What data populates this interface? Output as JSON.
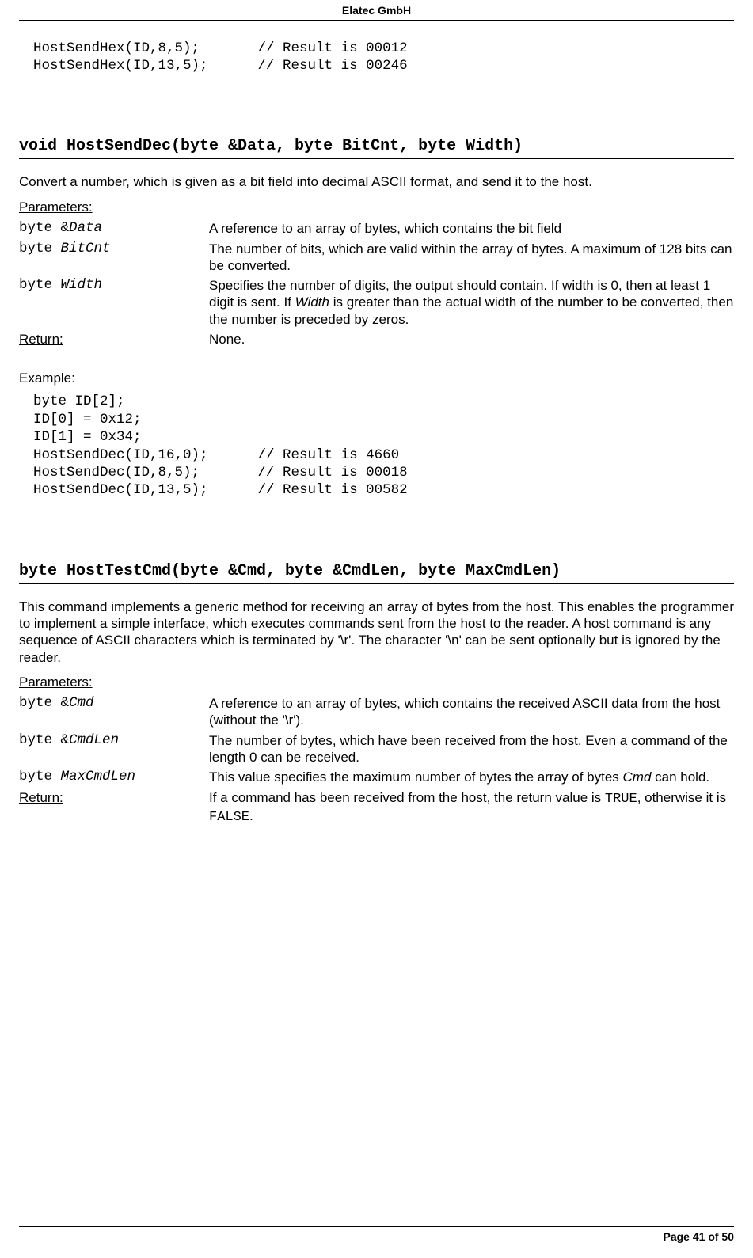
{
  "header": {
    "company": "Elatec GmbH"
  },
  "footer": {
    "page": "Page 41 of 50"
  },
  "intro_code": "HostSendHex(ID,8,5);       // Result is 00012\nHostSendHex(ID,13,5);      // Result is 00246",
  "s1": {
    "title": "void HostSendDec(byte &Data, byte BitCnt, byte Width)",
    "desc": "Convert a number, which is given as a bit field into decimal ASCII format, and send it to the host.",
    "params_h": "Parameters:",
    "p1_type": "byte &",
    "p1_name": "Data",
    "p1_desc": "A reference to an array of bytes, which contains the bit field",
    "p2_type": "byte ",
    "p2_name": "BitCnt",
    "p2_desc": "The number of bits, which are valid within the array of bytes. A maximum of 128 bits can be converted.",
    "p3_type": "byte ",
    "p3_name": "Width",
    "p3_desc_a": "Specifies the number of digits, the output should contain. If width is 0, then at least 1 digit is sent. If ",
    "p3_desc_i": "Width",
    "p3_desc_b": " is greater than the actual width of the number to be converted, then the number is preceded by zeros.",
    "return_h": "Return:",
    "return_v": "None.",
    "example_h": "Example:",
    "example_code": "byte ID[2];\nID[0] = 0x12;\nID[1] = 0x34;\nHostSendDec(ID,16,0);      // Result is 4660\nHostSendDec(ID,8,5);       // Result is 00018\nHostSendDec(ID,13,5);      // Result is 00582"
  },
  "s2": {
    "title": "byte HostTestCmd(byte &Cmd, byte &CmdLen, byte MaxCmdLen)",
    "desc": "This command implements a generic method for receiving an array of bytes from the host. This enables the programmer to implement a simple interface, which executes commands sent from the host to the reader. A host command is any sequence of ASCII characters which is terminated by '\\r'. The character '\\n' can be sent optionally but is ignored by the reader.",
    "params_h": "Parameters:",
    "p1_type": "byte &",
    "p1_name": "Cmd",
    "p1_desc": "A reference to an array of bytes, which contains the received ASCII data from the host (without the '\\r').",
    "p2_type": "byte &",
    "p2_name": "CmdLen",
    "p2_desc": "The number of bytes, which have been received from the host. Even a command of the length 0 can be received.",
    "p3_type": "byte ",
    "p3_name": "MaxCmdLen",
    "p3_desc_a": "This value specifies the maximum number of bytes the array of bytes ",
    "p3_desc_i": "Cmd",
    "p3_desc_b": " can hold.",
    "return_h": "Return:",
    "return_a": "If a command has been received from the host, the return value is ",
    "return_m1": "TRUE",
    "return_b": ", otherwise it is ",
    "return_m2": "FALSE",
    "return_c": "."
  }
}
